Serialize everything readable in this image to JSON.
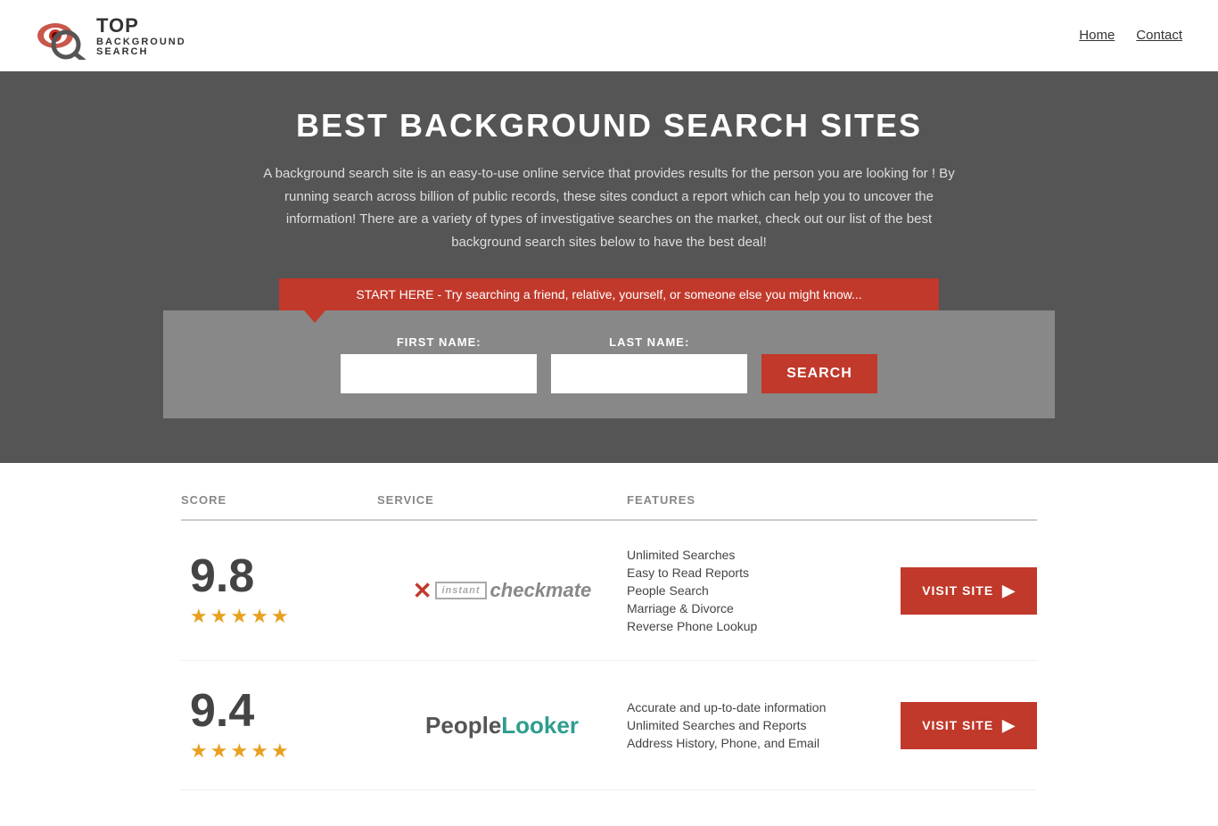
{
  "header": {
    "logo_top": "TOP",
    "logo_sub1": "BACKGROUND",
    "logo_sub2": "SEARCH",
    "nav": [
      {
        "label": "Home",
        "href": "#"
      },
      {
        "label": "Contact",
        "href": "#"
      }
    ]
  },
  "hero": {
    "title": "BEST BACKGROUND SEARCH SITES",
    "description": "A background search site is an easy-to-use online service that provides results  for the person you are looking for ! By  running  search across billion of public records, these sites conduct  a report which can help you to uncover the information! There are a variety of types of investigative searches on the market, check out our  list of the best background search sites below to have the best deal!",
    "banner_text": "START HERE - Try searching a friend, relative, yourself, or someone else you might know...",
    "first_name_label": "FIRST NAME:",
    "last_name_label": "LAST NAME:",
    "search_button": "SEARCH"
  },
  "table": {
    "headers": [
      "SCORE",
      "SERVICE",
      "FEATURES"
    ],
    "rows": [
      {
        "score": "9.8",
        "stars": 4.5,
        "service_name": "Instant Checkmate",
        "features": [
          "Unlimited Searches",
          "Easy to Read Reports",
          "People Search",
          "Marriage & Divorce",
          "Reverse Phone Lookup"
        ],
        "visit_label": "VISIT SITE"
      },
      {
        "score": "9.4",
        "stars": 4.5,
        "service_name": "PeopleLooker",
        "features": [
          "Accurate and up-to-date information",
          "Unlimited Searches and Reports",
          "Address History, Phone, and Email"
        ],
        "visit_label": "VISIT SITE"
      }
    ]
  }
}
